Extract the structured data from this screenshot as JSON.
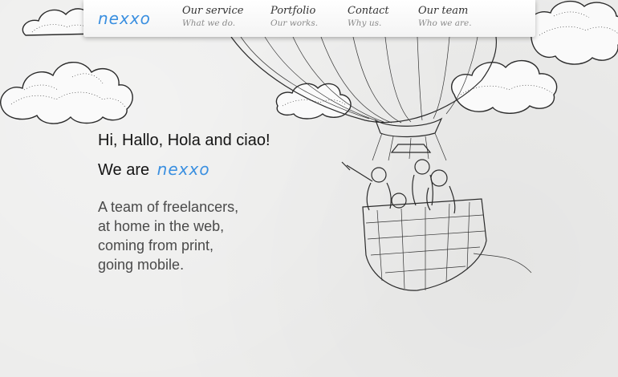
{
  "brand": {
    "logo_text": "nexxo",
    "accent_color": "#3a8fe0"
  },
  "nav": {
    "items": [
      {
        "title": "Our service",
        "subtitle": "What we do."
      },
      {
        "title": "Portfolio",
        "subtitle": "Our works."
      },
      {
        "title": "Contact",
        "subtitle": "Why us."
      },
      {
        "title": "Our team",
        "subtitle": "Who we are."
      }
    ]
  },
  "hero": {
    "greeting": "Hi, Hallo, Hola and ciao!",
    "we_are": "We are",
    "brand_name": "nexxo",
    "intro_lines": [
      "A team of freelancers,",
      "at home in the web,",
      "coming from print,",
      "going mobile."
    ]
  },
  "illustration": {
    "icons": [
      "cloud-icon",
      "hot-air-balloon-icon",
      "balloon-basket-icon"
    ]
  }
}
